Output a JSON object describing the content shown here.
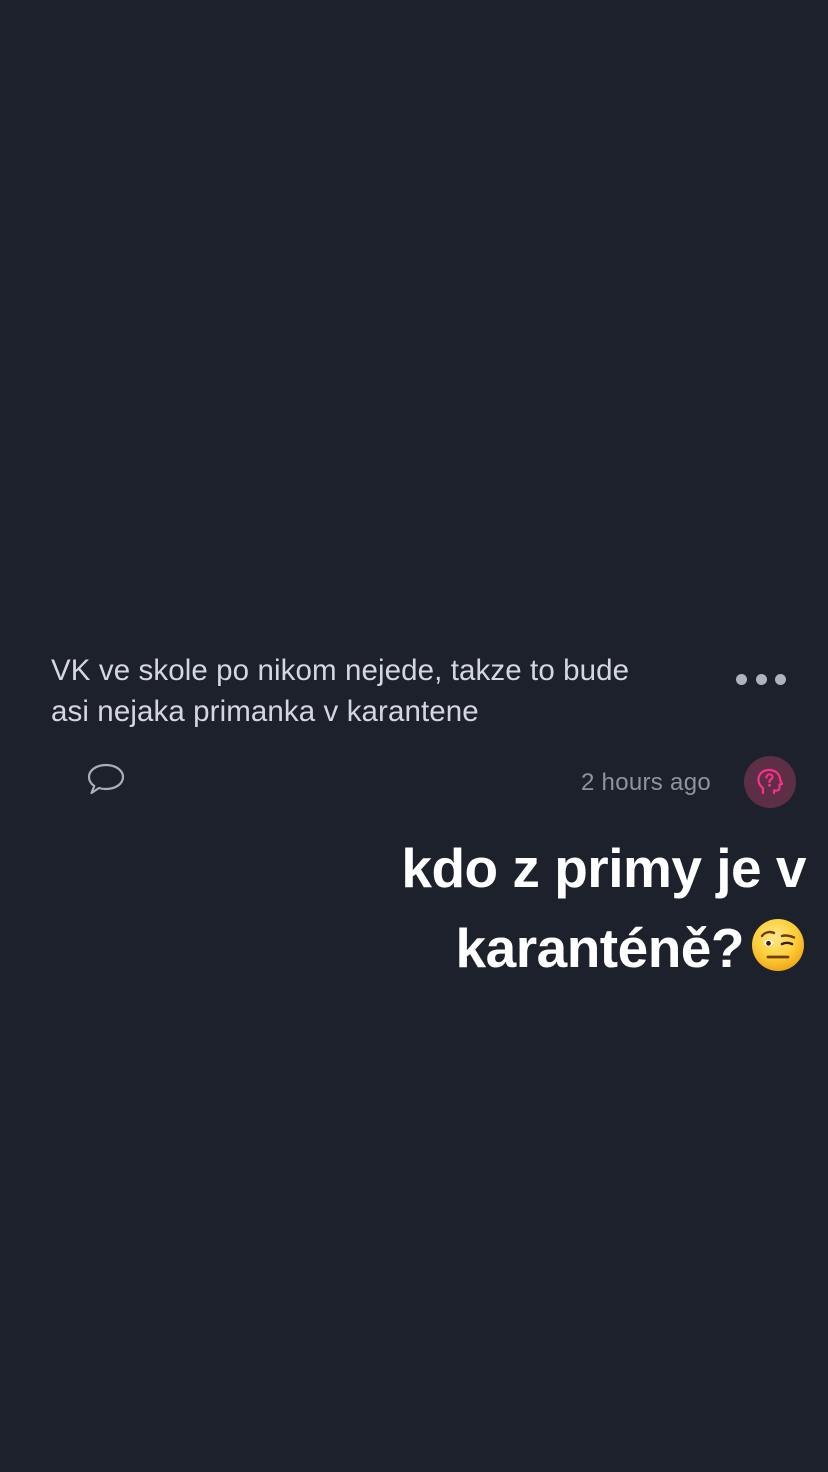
{
  "post": {
    "text_line1": "VK ve skole po nikom nejede, takze to bude",
    "text_line2": "asi nejaka primanka v karantene",
    "timestamp": "2 hours ago"
  },
  "icons": {
    "more": "more-dots-icon",
    "comment": "comment-bubble-icon",
    "avatar": "question-head-icon",
    "emoji": "face-with-raised-eyebrow-emoji"
  },
  "caption": {
    "line1": "kdo z primy je v",
    "line2": "karanténě?"
  },
  "colors": {
    "background": "#1c212c",
    "avatar_bg": "#5d2f46",
    "avatar_icon": "#ff2d8a"
  }
}
